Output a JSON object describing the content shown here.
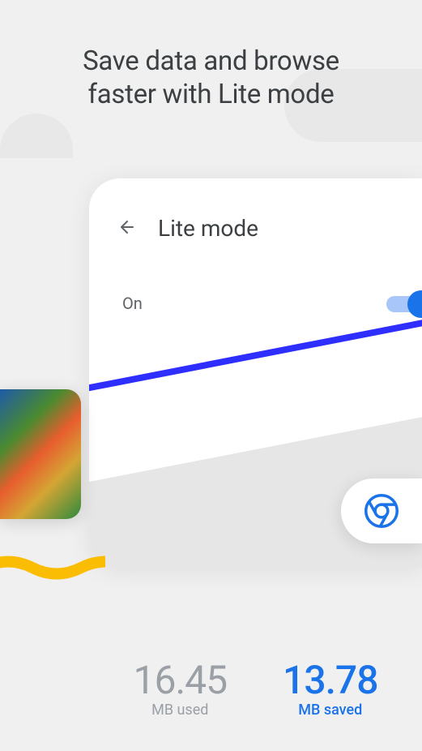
{
  "headline": {
    "line1": "Save data and browse",
    "line2": "faster with Lite mode"
  },
  "card": {
    "title": "Lite mode",
    "toggle_label": "On",
    "toggle_state": true
  },
  "stats": {
    "used": {
      "value": "16.45",
      "label": "MB used"
    },
    "saved": {
      "value": "13.78",
      "label": "MB saved"
    }
  },
  "icons": {
    "back": "back-arrow-icon",
    "chrome": "chrome-icon"
  }
}
